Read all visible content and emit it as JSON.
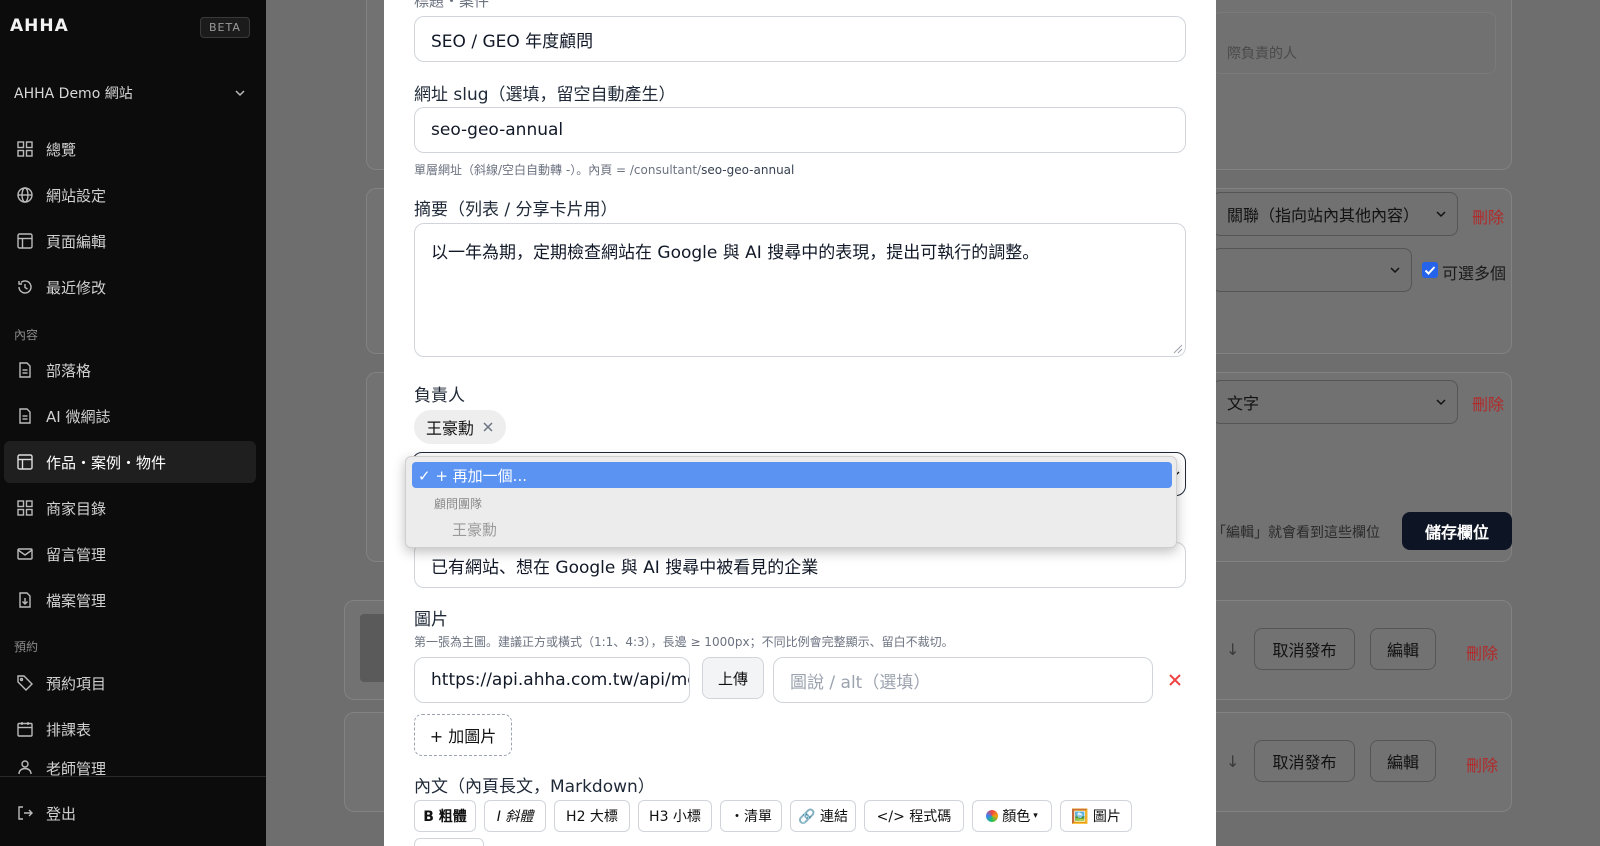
{
  "sidebar": {
    "brand": "AHHA",
    "beta": "BETA",
    "site_select": "AHHA Demo 網站",
    "items": [
      {
        "label": "總覽"
      },
      {
        "label": "網站設定"
      },
      {
        "label": "頁面編輯"
      },
      {
        "label": "最近修改"
      },
      {
        "label": "部落格"
      },
      {
        "label": "AI 微網誌"
      },
      {
        "label": "作品・案例・物件"
      },
      {
        "label": "商家目錄"
      },
      {
        "label": "留言管理"
      },
      {
        "label": "檔案管理"
      },
      {
        "label": "預約項目"
      },
      {
        "label": "排課表"
      },
      {
        "label": "老師管理"
      }
    ],
    "section_content": "內容",
    "section_booking": "預約",
    "logout": "登出"
  },
  "background": {
    "partial_placeholder": "際負責的人",
    "relation_select": "關聯（指向站內其他內容）",
    "delete": "刪除",
    "multi_select_label": "可選多個",
    "text_select": "文字",
    "edit_hint": "「編輯」就會看到這些欄位",
    "save_fields": "儲存欄位",
    "unpublish": "取消發布",
    "edit": "編輯"
  },
  "modal": {
    "title_label_partial": "標題・案件",
    "title_value": "SEO / GEO 年度顧問",
    "slug_label": "網址 slug（選填，留空自動產生）",
    "slug_value": "seo-geo-annual",
    "slug_hint_prefix": "單層網址（斜線/空白自動轉 -）。內頁 = /consultant/",
    "slug_hint_slug": "seo-geo-annual",
    "summary_label": "摘要（列表 / 分享卡片用）",
    "summary_value": "以一年為期，定期檢查網站在 Google 與 AI 搜尋中的表現，提出可執行的調整。",
    "owner_label": "負責人",
    "owner_chip": "王豪勳",
    "audience_value": "已有網站、想在 Google 與 AI 搜尋中被看見的企業",
    "image_label": "圖片",
    "image_hint": "第一張為主圖。建議正方或橫式（1:1、4:3），長邊 ≥ 1000px；不同比例會完整顯示、留白不裁切。",
    "image_url": "https://api.ahha.com.tw/api/media",
    "upload": "上傳",
    "alt_placeholder": "圖說 / alt（選填）",
    "add_image": "+ 加圖片",
    "body_label": "內文（內頁長文，Markdown）",
    "toolbar": {
      "bold": "B 粗體",
      "italic": "I 斜體",
      "h2": "H2 大標",
      "h3": "H3 小標",
      "list": "・清單",
      "link": "🔗 連結",
      "code": "</> 程式碼",
      "color": "顏色",
      "image": "🖼️ 圖片"
    }
  },
  "dropdown": {
    "selected": "✓ + 再加一個...",
    "group": "顧問團隊",
    "option": "王豪勳"
  },
  "colors": {
    "accent_blue": "#5a93f2",
    "delete_red": "#b22a2a",
    "remove_x_red": "#ef4444",
    "dark_button": "#0d1424"
  }
}
